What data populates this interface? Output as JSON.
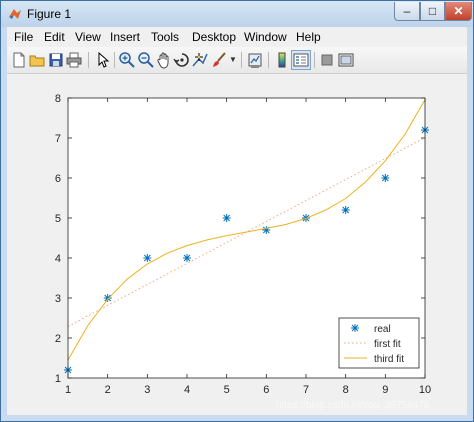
{
  "window": {
    "title": "Figure 1",
    "minimize_glyph": "–",
    "maximize_glyph": "□",
    "close_glyph": "✕"
  },
  "menu": {
    "items": [
      "File",
      "Edit",
      "View",
      "Insert",
      "Tools",
      "Desktop",
      "Window",
      "Help"
    ]
  },
  "toolbar": {
    "icons": [
      "new-figure-icon",
      "open-file-icon",
      "save-icon",
      "print-icon",
      "pointer-icon",
      "zoom-in-icon",
      "zoom-out-icon",
      "pan-icon",
      "rotate-icon",
      "data-cursor-icon",
      "brush-icon",
      "link-plot-icon",
      "colorbar-icon",
      "legend-icon",
      "hide-plot-tools-icon",
      "show-plot-tools-icon"
    ]
  },
  "watermark": "https://blog.csdn.net/qq_38758478",
  "colors": {
    "real": "#0072bd",
    "first_fit": "#f4a582",
    "third_fit": "#edb120"
  },
  "chart_data": {
    "type": "line",
    "title": "",
    "xlabel": "",
    "ylabel": "",
    "xlim": [
      1,
      10
    ],
    "ylim": [
      1,
      8
    ],
    "xticks": [
      "1",
      "2",
      "3",
      "4",
      "5",
      "6",
      "7",
      "8",
      "9",
      "10"
    ],
    "yticks": [
      "1",
      "2",
      "3",
      "4",
      "5",
      "6",
      "7",
      "8"
    ],
    "grid": false,
    "legend_position": "bottom-right",
    "series": [
      {
        "name": "real",
        "style": "markers",
        "marker": "*",
        "x": [
          1,
          2,
          3,
          4,
          5,
          6,
          7,
          8,
          9,
          10
        ],
        "y": [
          1.2,
          3.0,
          4.0,
          4.0,
          5.0,
          4.7,
          5.0,
          5.2,
          6.0,
          7.2
        ]
      },
      {
        "name": "first fit",
        "style": "dotted",
        "x": [
          1,
          10
        ],
        "y": [
          2.29,
          7.01
        ]
      },
      {
        "name": "third fit",
        "style": "solid",
        "x": [
          1,
          1.5,
          2,
          2.5,
          3,
          3.5,
          4,
          4.5,
          5,
          5.5,
          6,
          6.5,
          7,
          7.5,
          8,
          8.5,
          9,
          9.5,
          10
        ],
        "y": [
          1.45,
          2.31,
          2.97,
          3.48,
          3.85,
          4.12,
          4.31,
          4.45,
          4.56,
          4.65,
          4.74,
          4.84,
          4.99,
          5.2,
          5.49,
          5.9,
          6.43,
          7.1,
          7.96
        ]
      }
    ]
  }
}
